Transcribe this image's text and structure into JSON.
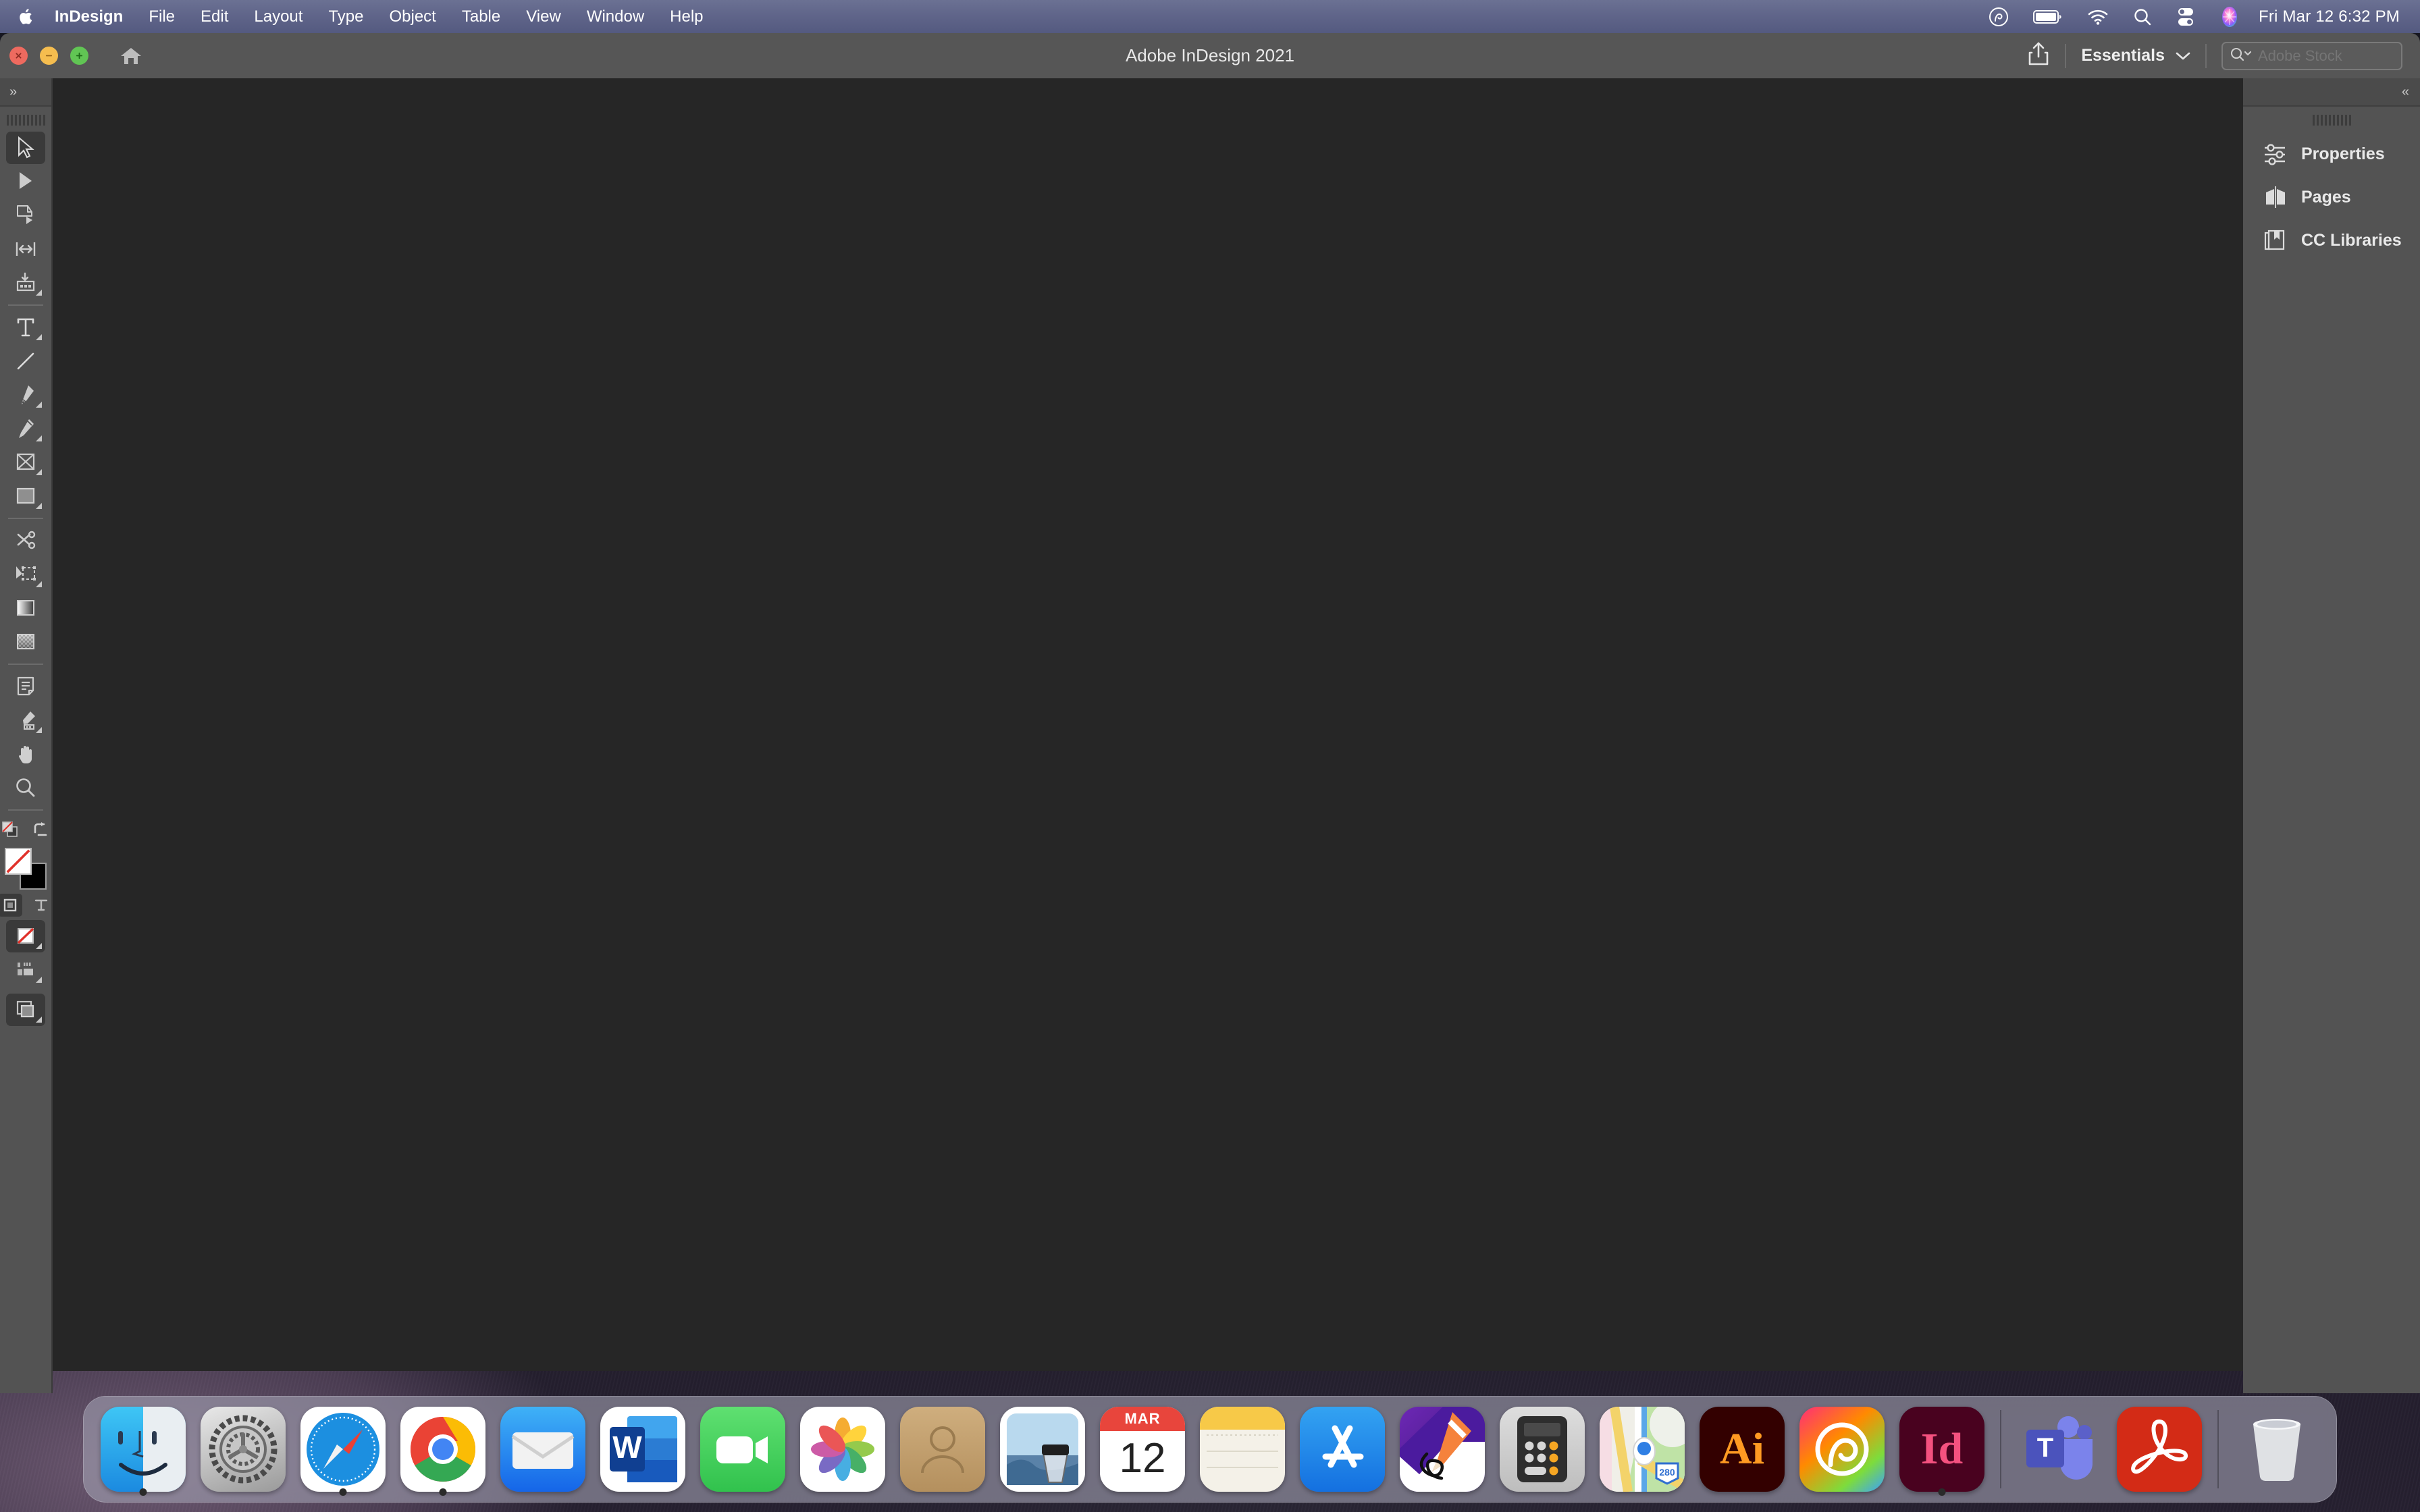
{
  "menubar": {
    "apple_icon": "apple-logo",
    "items": [
      {
        "label": "InDesign",
        "bold": true
      },
      {
        "label": "File",
        "bold": false
      },
      {
        "label": "Edit",
        "bold": false
      },
      {
        "label": "Layout",
        "bold": false
      },
      {
        "label": "Type",
        "bold": false
      },
      {
        "label": "Object",
        "bold": false
      },
      {
        "label": "Table",
        "bold": false
      },
      {
        "label": "View",
        "bold": false
      },
      {
        "label": "Window",
        "bold": false
      },
      {
        "label": "Help",
        "bold": false
      }
    ],
    "status_icons": [
      "creative-cloud-icon",
      "battery-icon",
      "wifi-icon",
      "spotlight-search-icon",
      "control-center-icon",
      "siri-icon"
    ],
    "clock": "Fri Mar 12  6:32 PM"
  },
  "window": {
    "title": "Adobe InDesign 2021",
    "traffic_lights": [
      "close",
      "minimize",
      "zoom"
    ],
    "home_button": "home-icon",
    "share_button": "share-icon",
    "workspace": {
      "name": "Essentials",
      "caret": "chevron-down-icon"
    },
    "stock_search": {
      "icon": "search-icon",
      "placeholder": "Adobe Stock",
      "value": ""
    }
  },
  "toolbar": {
    "collapse_label": "»",
    "tools": [
      {
        "name": "selection-tool",
        "active": true,
        "flyout": false
      },
      {
        "name": "direct-selection-tool",
        "active": false,
        "flyout": false
      },
      {
        "name": "page-tool",
        "active": false,
        "flyout": false
      },
      {
        "name": "gap-tool",
        "active": false,
        "flyout": false
      },
      {
        "name": "content-collector-tool",
        "active": false,
        "flyout": true
      },
      {
        "name": "type-tool",
        "active": false,
        "flyout": true
      },
      {
        "name": "line-tool",
        "active": false,
        "flyout": false
      },
      {
        "name": "pen-tool",
        "active": false,
        "flyout": true
      },
      {
        "name": "pencil-tool",
        "active": false,
        "flyout": true
      },
      {
        "name": "frame-tool",
        "active": false,
        "flyout": true
      },
      {
        "name": "rectangle-tool",
        "active": false,
        "flyout": true
      },
      {
        "name": "scissors-tool",
        "active": false,
        "flyout": false
      },
      {
        "name": "free-transform-tool",
        "active": false,
        "flyout": true
      },
      {
        "name": "gradient-swatch-tool",
        "active": false,
        "flyout": false
      },
      {
        "name": "gradient-feather-tool",
        "active": false,
        "flyout": false
      },
      {
        "name": "note-tool",
        "active": false,
        "flyout": false
      },
      {
        "name": "eyedropper-tool",
        "active": false,
        "flyout": true
      },
      {
        "name": "hand-tool",
        "active": false,
        "flyout": false
      },
      {
        "name": "zoom-tool",
        "active": false,
        "flyout": false
      }
    ],
    "fill_color": "#ffffff",
    "stroke_color": "#000000",
    "stroke_is_none": true,
    "swap_icon": "swap-fill-stroke-icon",
    "default_icon": "default-fill-stroke-icon",
    "format_container_icon": "format-affects-container-icon",
    "format_text_icon": "format-affects-text-icon",
    "apply_none_icon": "apply-none-icon",
    "apply_gradient_icon": "apply-gradient-icon",
    "screen_mode_icon": "screen-mode-icon"
  },
  "right_panel": {
    "collapse_label": "«",
    "items": [
      {
        "label": "Properties",
        "icon": "sliders-icon"
      },
      {
        "label": "Pages",
        "icon": "pages-spread-icon"
      },
      {
        "label": "CC Libraries",
        "icon": "cc-libraries-icon"
      }
    ]
  },
  "dock": {
    "items": [
      {
        "name": "finder",
        "label": "Finder",
        "running": true
      },
      {
        "name": "sysprefs",
        "label": "System Preferences",
        "running": false
      },
      {
        "name": "safari",
        "label": "Safari",
        "running": true
      },
      {
        "name": "chrome",
        "label": "Google Chrome",
        "running": true
      },
      {
        "name": "mail",
        "label": "Mail",
        "running": false
      },
      {
        "name": "word",
        "label": "Microsoft Word",
        "running": false
      },
      {
        "name": "facetime",
        "label": "FaceTime",
        "running": false
      },
      {
        "name": "photos",
        "label": "Photos",
        "running": false
      },
      {
        "name": "contacts",
        "label": "Contacts",
        "running": false
      },
      {
        "name": "preview",
        "label": "Preview",
        "running": false
      },
      {
        "name": "calendar",
        "label": "Calendar",
        "running": false,
        "month": "MAR",
        "day": "12"
      },
      {
        "name": "notes",
        "label": "Notes",
        "running": false
      },
      {
        "name": "appstore",
        "label": "App Store",
        "running": false
      },
      {
        "name": "freeform",
        "label": "Freeform",
        "running": false
      },
      {
        "name": "calculator",
        "label": "Calculator",
        "running": false
      },
      {
        "name": "maps",
        "label": "Maps",
        "running": false,
        "route": "280"
      },
      {
        "name": "illustrator",
        "label": "Adobe Illustrator",
        "running": false,
        "letters": "Ai"
      },
      {
        "name": "creativecloud",
        "label": "Creative Cloud",
        "running": false
      },
      {
        "name": "indesign",
        "label": "Adobe InDesign",
        "running": true,
        "letters": "Id"
      },
      {
        "name": "teams",
        "label": "Microsoft Teams",
        "running": false,
        "letters": "T"
      },
      {
        "name": "acrobat",
        "label": "Adobe Acrobat",
        "running": false
      }
    ],
    "trash": {
      "name": "trash",
      "label": "Trash"
    }
  },
  "colors": {
    "menubar": "#5f6489",
    "titlebar": "#565656",
    "panel": "#535353",
    "canvas": "#262626",
    "accent_red": "#ee6a5f",
    "accent_yellow": "#f5bd4f",
    "accent_green": "#61c554"
  }
}
